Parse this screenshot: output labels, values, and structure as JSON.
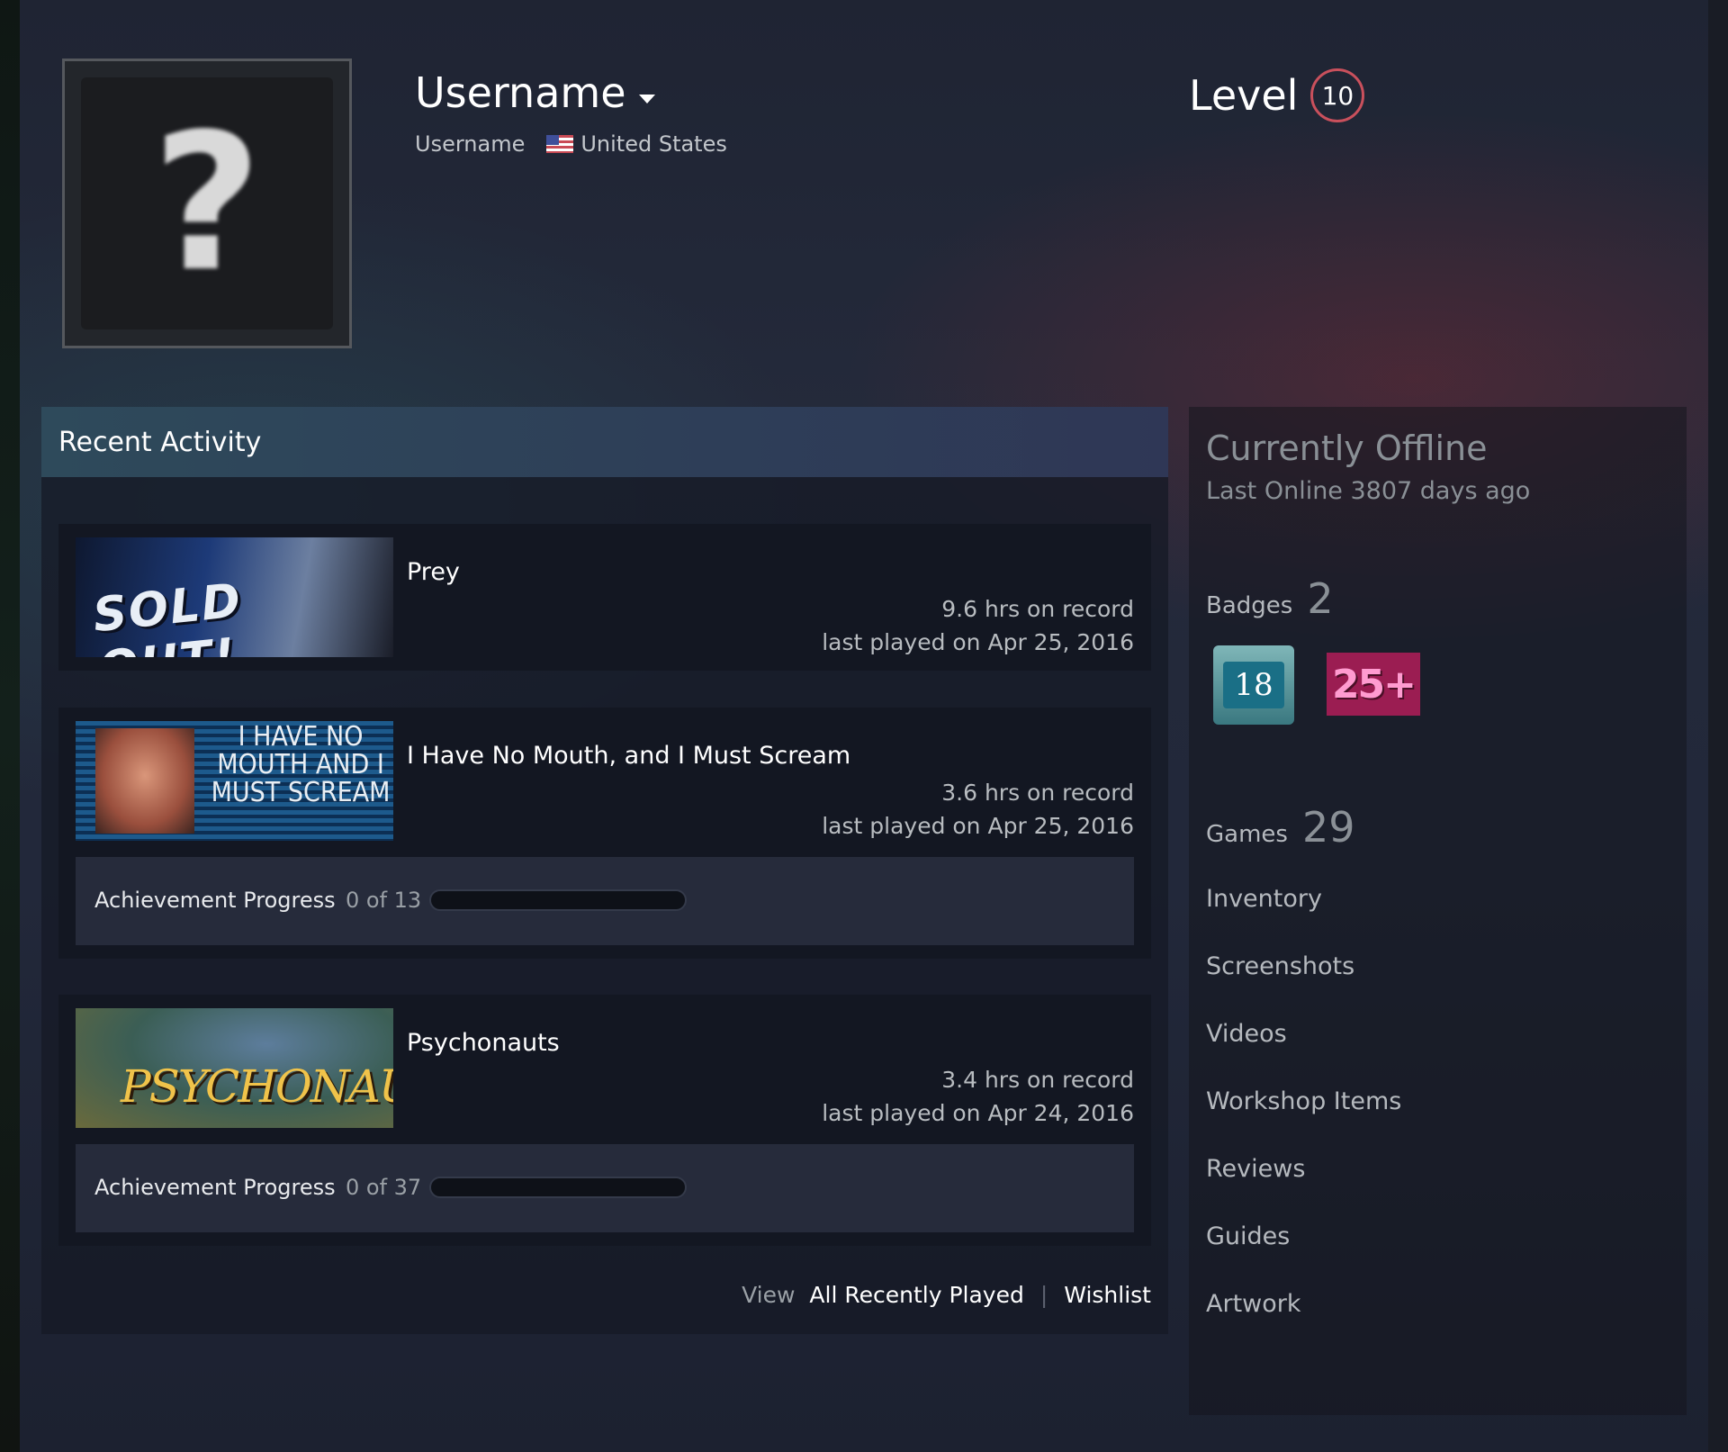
{
  "header": {
    "persona_name": "Username",
    "real_name": "Username",
    "country": "United States",
    "level_label": "Level",
    "level_value": "10"
  },
  "recent_activity": {
    "title": "Recent Activity",
    "games": [
      {
        "name": "Prey",
        "capsule_text": "SOLD OUT!",
        "hours": "9.6 hrs on record",
        "last_played": "last played on Apr 25, 2016"
      },
      {
        "name": "I Have No Mouth, and I Must Scream",
        "capsule_text": "I HAVE NO MOUTH AND I MUST SCREAM",
        "hours": "3.6 hrs on record",
        "last_played": "last played on Apr 25, 2016",
        "achievement_label": "Achievement Progress",
        "achievement_count": "0 of 13",
        "achievement_fraction": 0
      },
      {
        "name": "Psychonauts",
        "capsule_text": "PSYCHONAUTS",
        "hours": "3.4 hrs on record",
        "last_played": "last played on Apr 24, 2016",
        "achievement_label": "Achievement Progress",
        "achievement_count": "0 of 37",
        "achievement_fraction": 0
      }
    ],
    "view_label": "View",
    "all_recently_played": "All Recently Played",
    "separator": "|",
    "wishlist": "Wishlist"
  },
  "sidebar": {
    "status": "Currently Offline",
    "last_online": "Last Online 3807 days ago",
    "badges_label": "Badges",
    "badges_count": "2",
    "badge_items": [
      "18",
      "25+"
    ],
    "games_label": "Games",
    "games_count": "29",
    "links": [
      "Inventory",
      "Screenshots",
      "Videos",
      "Workshop Items",
      "Reviews",
      "Guides",
      "Artwork"
    ]
  },
  "colors": {
    "accent_level": "#c9505c",
    "activity_header": "#2e4a5b",
    "progress_fill": "#5aa3d8"
  }
}
